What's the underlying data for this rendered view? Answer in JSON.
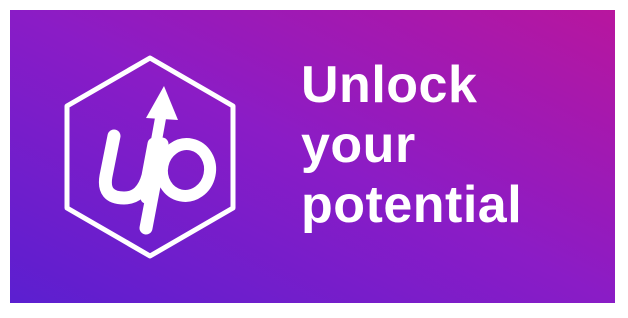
{
  "banner": {
    "gradient": {
      "start": "#6a1fc9",
      "middle": "#8e1dc4",
      "end": "#b3169f"
    },
    "logo": {
      "icon": "up-arrow-hexagon-icon",
      "text": "up",
      "color": "#ffffff"
    },
    "tagline": {
      "line1": "Unlock",
      "line2": "your",
      "line3": "potential"
    }
  }
}
